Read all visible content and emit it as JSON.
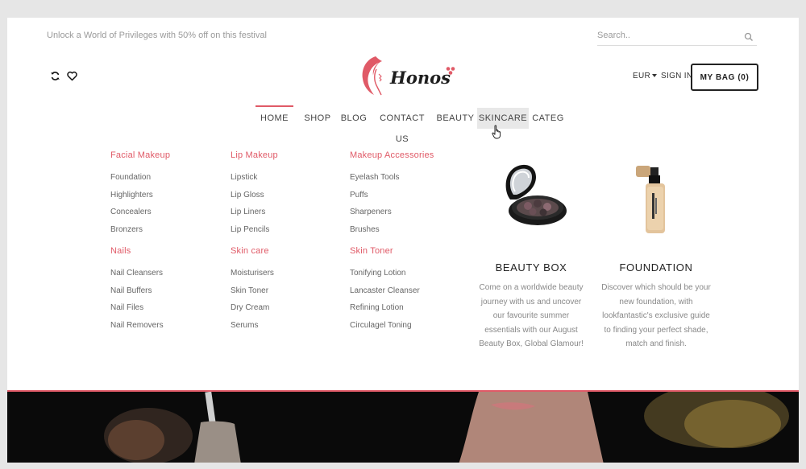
{
  "promo_text": "Unlock a World of Privileges with 50% off on this festival",
  "search": {
    "placeholder": "Search.."
  },
  "icons": {
    "compare": "refresh-icon",
    "wishlist": "heart-icon",
    "search": "search-icon",
    "cursor": "hand-pointer-icon"
  },
  "brand": {
    "name": "Honos",
    "accent": "#e05a67"
  },
  "currency": "EUR",
  "signin_label": "SIGN IN",
  "bag_label": "MY BAG (0)",
  "nav": {
    "items": [
      "HOME",
      "SHOP",
      "BLOG",
      "CONTACT US",
      "BEAUTY",
      "SKINCARE",
      "CATEG"
    ]
  },
  "mega_menu": {
    "columns": [
      {
        "heading": "Facial Makeup",
        "links": [
          "Foundation",
          "Highlighters",
          "Concealers",
          "Bronzers"
        ]
      },
      {
        "heading": "Lip Makeup",
        "links": [
          "Lipstick",
          "Lip Gloss",
          "Lip Liners",
          "Lip Pencils"
        ]
      },
      {
        "heading": "Makeup Accessories",
        "links": [
          "Eyelash Tools",
          "Puffs",
          "Sharpeners",
          "Brushes"
        ]
      },
      {
        "heading": "Nails",
        "links": [
          "Nail Cleansers",
          "Nail Buffers",
          "Nail Files",
          "Nail Removers"
        ]
      },
      {
        "heading": "Skin care",
        "links": [
          "Moisturisers",
          "Skin Toner",
          "Dry Cream",
          "Serums"
        ]
      },
      {
        "heading": "Skin Toner",
        "links": [
          "Tonifying Lotion",
          "Lancaster Cleanser",
          "Refining Lotion",
          "Circulagel Toning"
        ]
      }
    ],
    "features": [
      {
        "title": "BEAUTY BOX",
        "lines": [
          "Come on a worldwide beauty",
          "journey with us and uncover",
          "our favourite summer",
          "essentials with our August",
          "Beauty Box, Global Glamour!"
        ]
      },
      {
        "title": "FOUNDATION",
        "lines": [
          "Discover which should be your",
          "new foundation, with",
          "lookfantastic's exclusive guide",
          "to finding your perfect shade,",
          "match and finish."
        ]
      }
    ]
  }
}
